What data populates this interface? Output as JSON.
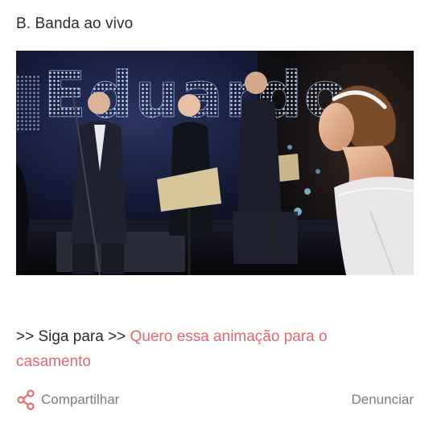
{
  "post": {
    "heading": "B. Banda ao vivo",
    "photo_sign_text": "Eduardo",
    "follow_prefix": ">> Siga para >> ",
    "follow_link": "Quero essa animação para o casamento"
  },
  "actions": {
    "share_label": "Compartilhar",
    "share_icon": "share-icon",
    "report_label": "Denunciar"
  },
  "colors": {
    "link": "#e4676b",
    "muted": "#7d7d7d",
    "text": "#2b2b2b"
  }
}
